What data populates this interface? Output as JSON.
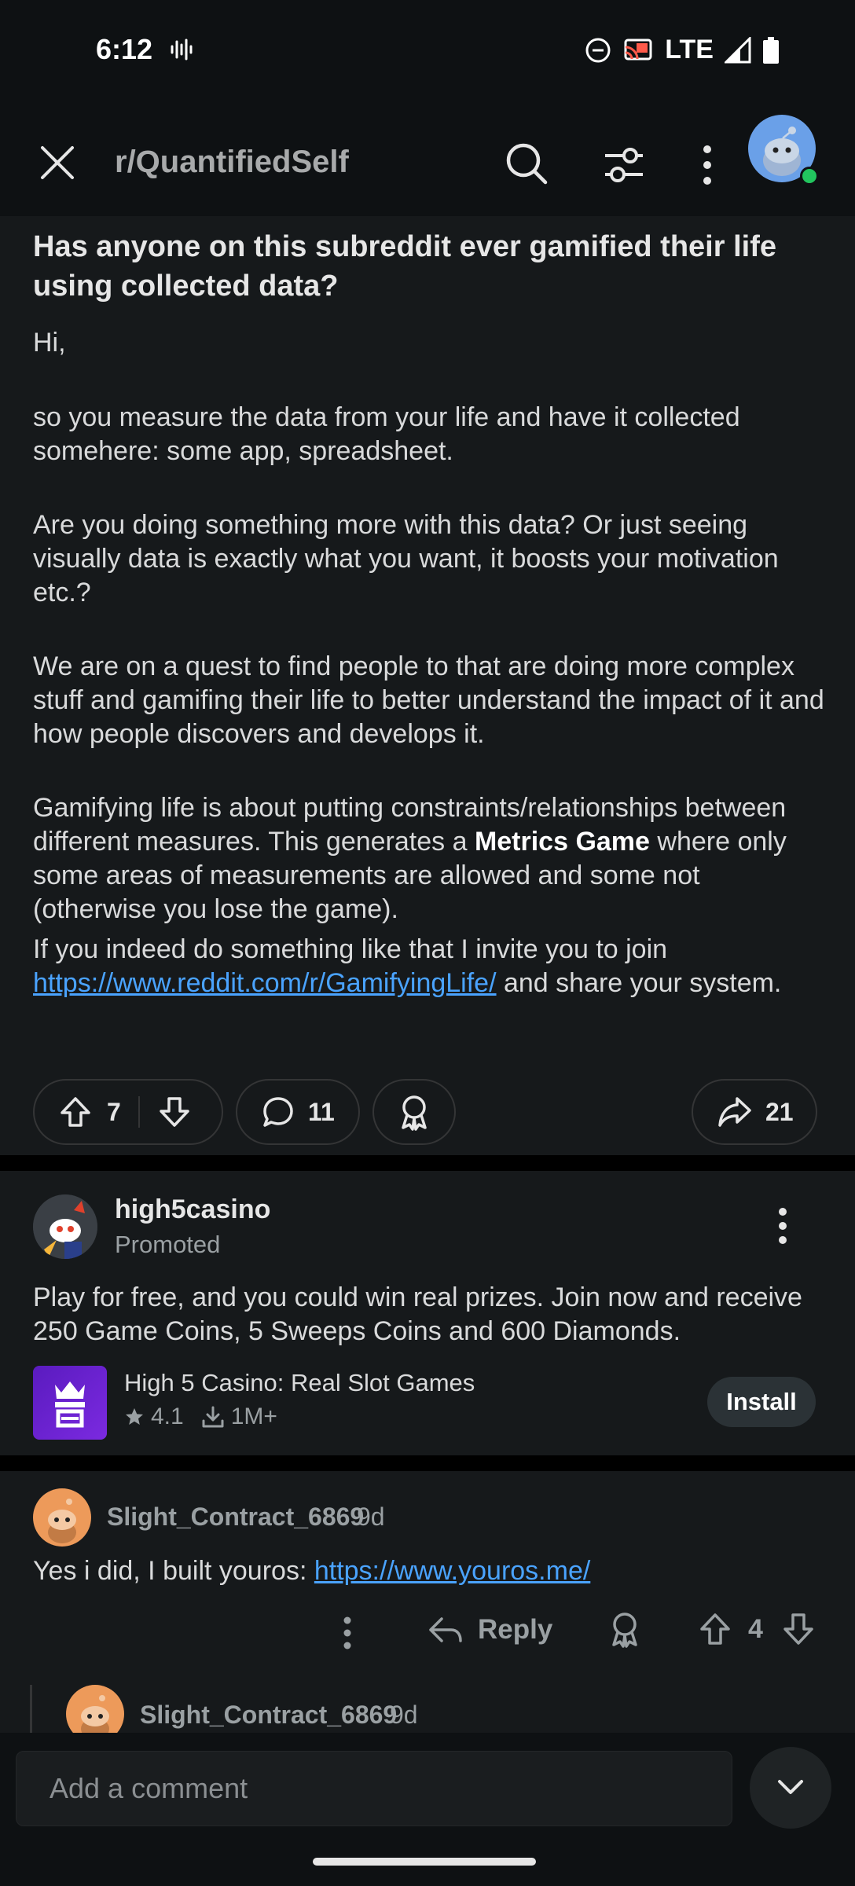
{
  "status_bar": {
    "time": "6:12",
    "network": "LTE"
  },
  "header": {
    "subreddit": "r/QuantifiedSelf"
  },
  "post": {
    "title": "Has anyone on this subreddit ever gamified their life using collected data?",
    "p1": "Hi,",
    "p2": "so you measure the data from your life and have it collected somehere: some app, spreadsheet.",
    "p3": "Are you doing something more with this data? Or just seeing visually data is exactly what you want, it boosts your motivation etc.?",
    "p4": "We are on a quest to find people to that are doing more complex stuff and gamifing their life to better understand the impact of it and how people discovers and develops it.",
    "p5_before": "Gamifying life is about putting constraints/relationships between different measures. This generates a ",
    "p5_bold": "Metrics Game",
    "p5_after": " where only some areas of measurements are allowed and some not (otherwise you lose the game).",
    "p6_before": "If you indeed do something like that I invite you to join ",
    "p6_link": "https://www.reddit.com/r/GamifyingLife/",
    "p6_after": " and share your system.",
    "votes": "7",
    "comments": "11",
    "shares": "21"
  },
  "ad": {
    "advertiser": "high5casino",
    "promoted": "Promoted",
    "text": "Play for free, and you could win real prizes. Join now and receive 250 Game Coins, 5 Sweeps Coins and 600 Diamonds.",
    "app_name": "High 5 Casino: Real Slot Games",
    "rating": "4.1",
    "downloads": "1M+",
    "install_label": "Install"
  },
  "comments": [
    {
      "username": "Slight_Contract_6869",
      "age": "9d",
      "text_before": "Yes i did, I built youros: ",
      "link": "https://www.youros.me/",
      "reply_label": "Reply",
      "votes": "4"
    },
    {
      "username": "Slight_Contract_6869",
      "age": "9d"
    }
  ],
  "composer": {
    "placeholder": "Add a comment"
  }
}
